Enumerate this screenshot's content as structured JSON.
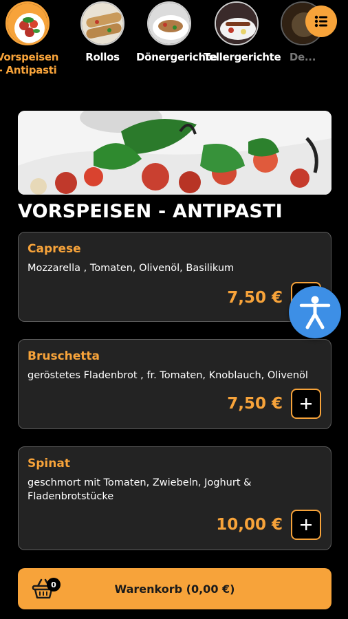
{
  "categories": [
    {
      "label": "Vorspeisen - Antipasti"
    },
    {
      "label": "Rollos"
    },
    {
      "label": "Dönergerichte"
    },
    {
      "label": "Tellergerichte"
    },
    {
      "label": "De..."
    }
  ],
  "menu_icon": "list-icon",
  "section": {
    "title": "VORSPEISEN - ANTIPASTI"
  },
  "items": [
    {
      "name": "Caprese",
      "description": "Mozzarella , Tomaten, Olivenöl, Basilikum",
      "price": "7,50 €",
      "add_icon": "plus-icon"
    },
    {
      "name": "Bruschetta",
      "description": "geröstetes Fladenbrot , fr. Tomaten, Knoblauch, Olivenöl",
      "price": "7,50 €",
      "add_icon": "plus-icon"
    },
    {
      "name": "Spinat",
      "description": "geschmort mit Tomaten, Zwiebeln, Joghurt & Fladenbrotstücke",
      "price": "10,00 €",
      "add_icon": "plus-icon"
    }
  ],
  "cart": {
    "count": "0",
    "label": "Warenkorb (0,00 €)",
    "icon": "basket-icon"
  },
  "accessibility": {
    "icon": "accessibility-icon"
  },
  "colors": {
    "accent": "#f7a33a",
    "background": "#000000",
    "card": "#232323",
    "a11y": "#3d8fe6"
  }
}
